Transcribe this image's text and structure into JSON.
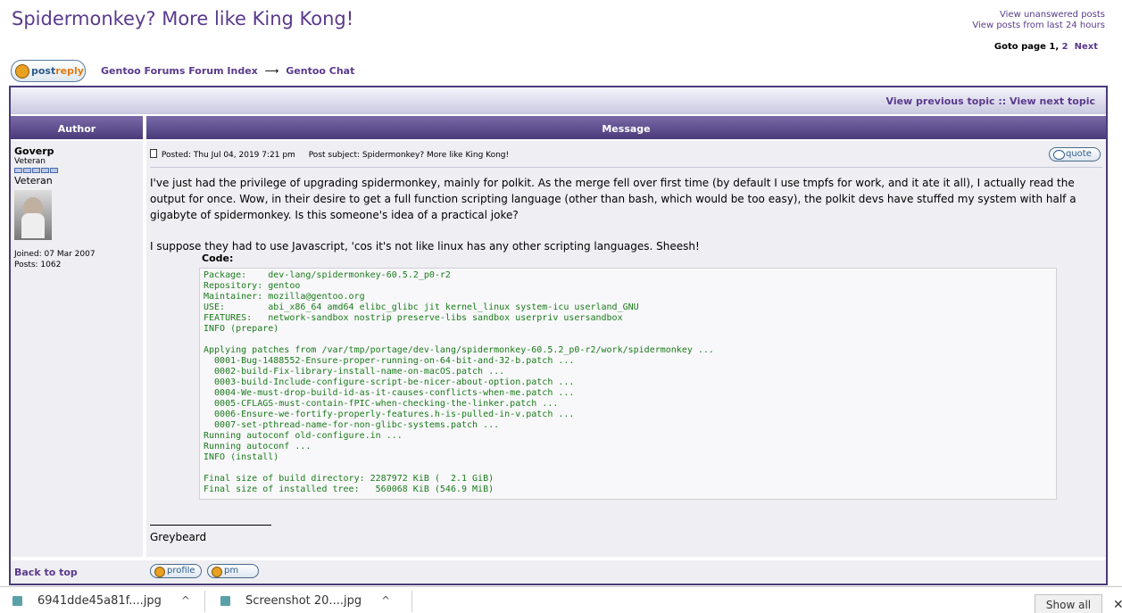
{
  "topic": {
    "title": "Spidermonkey? More like King Kong!"
  },
  "top_links": {
    "unanswered": "View unanswered posts",
    "last24": "View posts from last 24 hours"
  },
  "pagination": {
    "prefix": "Goto page",
    "current": "1",
    "sep": ",",
    "page2": "2",
    "next": "Next"
  },
  "actions": {
    "postreply_a": "post",
    "postreply_b": "reply"
  },
  "breadcrumb": {
    "index": "Gentoo Forums Forum Index",
    "arrow": "⟶",
    "forum": "Gentoo Chat"
  },
  "topic_nav": {
    "previous": "View previous topic",
    "sep": "::",
    "next": "View next topic"
  },
  "table": {
    "author_header": "Author",
    "message_header": "Message"
  },
  "author": {
    "name": "Goverp",
    "rank": "Veteran",
    "rank_title": "Veteran",
    "joined": "Joined: 07 Mar 2007",
    "posts": "Posts: 1062"
  },
  "post": {
    "posted": "Posted: Thu Jul 04, 2019 7:21 pm",
    "subject": "Post subject: Spidermonkey? More like King Kong!",
    "quote_label": "quote",
    "para1": "I've just had the privilege of upgrading spidermonkey, mainly for polkit. As the merge fell over first time (by default I use tmpfs for work, and it ate it all), I actually read the output for once. Wow, in their desire to get a full function scripting language (other than bash, which would be too easy), the polkit devs have stuffed my system with half a gigabyte of spidermonkey. Is this someone's idea of a practical joke?",
    "para2": "I suppose they had to use Javascript, 'cos it's not like linux has any other scripting languages. Sheesh!",
    "code_label": "Code:",
    "code": "Package:    dev-lang/spidermonkey-60.5.2_p0-r2\nRepository: gentoo\nMaintainer: mozilla@gentoo.org\nUSE:        abi_x86_64 amd64 elibc_glibc jit kernel_linux system-icu userland_GNU\nFEATURES:   network-sandbox nostrip preserve-libs sandbox userpriv usersandbox\nINFO (prepare)\n\nApplying patches from /var/tmp/portage/dev-lang/spidermonkey-60.5.2_p0-r2/work/spidermonkey ...\n  0001-Bug-1488552-Ensure-proper-running-on-64-bit-and-32-b.patch ...\n  0002-build-Fix-library-install-name-on-macOS.patch ...\n  0003-build-Include-configure-script-be-nicer-about-option.patch ...\n  0004-We-must-drop-build-id-as-it-causes-conflicts-when-me.patch ...\n  0005-CFLAGS-must-contain-fPIC-when-checking-the-linker.patch ...\n  0006-Ensure-we-fortify-properly-features.h-is-pulled-in-v.patch ...\n  0007-set-pthread-name-for-non-glibc-systems.patch ...\nRunning autoconf old-configure.in ...\nRunning autoconf ...\nINFO (install)\n\nFinal size of build directory: 2287972 KiB (  2.1 GiB)\nFinal size of installed tree:   560068 KiB (546.9 MiB)",
    "signature": "Greybeard"
  },
  "footer": {
    "back_to_top": "Back to top",
    "profile": "profile",
    "pm": "pm"
  },
  "downloads": {
    "items": [
      {
        "name": "6941dde45a81f....jpg"
      },
      {
        "name": "Screenshot 20....jpg"
      }
    ],
    "chevron": "^",
    "show_all": "Show all",
    "close": "✕"
  }
}
